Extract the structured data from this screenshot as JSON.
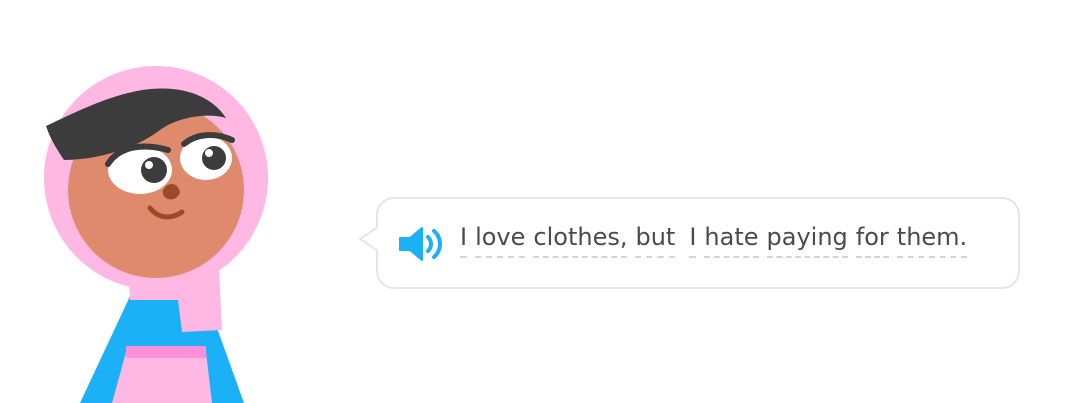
{
  "character": {
    "icon": "lily-character-icon",
    "skin_color": "#df8a6c",
    "hijab_color": "#ffb7e3",
    "hair_color": "#3c3c3c",
    "dress_color": "#1cb0f6"
  },
  "speech": {
    "audio_icon": "speaker-icon",
    "accent_color": "#1cb0f6",
    "words": [
      "I",
      "love",
      "clothes,",
      "but",
      "I",
      "hate",
      "paying",
      "for",
      "them."
    ]
  }
}
